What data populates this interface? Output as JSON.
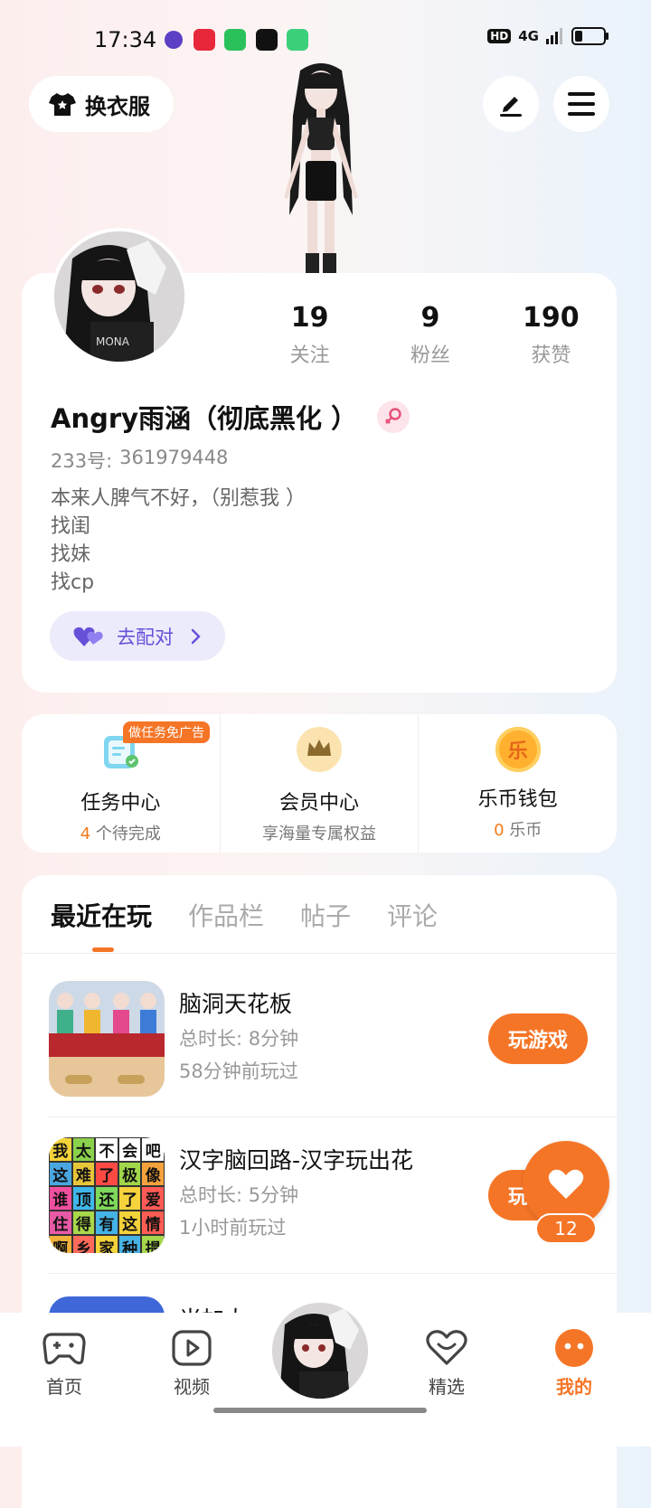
{
  "status_bar": {
    "time": "17:34",
    "hd": "HD",
    "network": "4G"
  },
  "header": {
    "outfit_label": "换衣服"
  },
  "profile": {
    "stats": [
      {
        "value": "19",
        "label": "关注"
      },
      {
        "value": "9",
        "label": "粉丝"
      },
      {
        "value": "190",
        "label": "获赞"
      }
    ],
    "username": "Angry雨涵（彻底黑化 ）",
    "id_label": "233号:",
    "id_value": "361979448",
    "bio": [
      "本来人脾气不好，（别惹我 ）",
      "找闺",
      "找妹",
      "找cp"
    ],
    "pair_label": "去配对"
  },
  "services": {
    "task": {
      "badge": "做任务免广告",
      "title": "任务中心",
      "count": "4",
      "sub": " 个待完成"
    },
    "vip": {
      "title": "会员中心",
      "sub": "享海量专属权益"
    },
    "wallet": {
      "title": "乐币钱包",
      "count": "0",
      "sub": " 乐币",
      "icon_text": "乐"
    }
  },
  "tabs": [
    "最近在玩",
    "作品栏",
    "帖子",
    "评论"
  ],
  "games": [
    {
      "name": "脑洞天花板",
      "duration": "总时长:  8分钟",
      "last_played": "58分钟前玩过",
      "button": "玩游戏"
    },
    {
      "name": "汉字脑回路-汉字玩出花",
      "duration": "总时长:  5分钟",
      "last_played": "1小时前玩过",
      "button": "玩游戏",
      "thumb_chars": [
        "我",
        "太",
        "不",
        "会",
        "吧",
        "这",
        "难",
        "了",
        "极",
        "像",
        "谁",
        "顶",
        "还",
        "了",
        "爱",
        "住",
        "得",
        "有",
        "这",
        "情",
        "啊",
        "乡",
        "家",
        "种",
        "提"
      ]
    },
    {
      "name": "当加大",
      "duration": "",
      "last_played": "",
      "button": ""
    }
  ],
  "like_count": "12",
  "nav": [
    "首页",
    "视频",
    "精选",
    "我的"
  ],
  "colors": {
    "accent": "#f57527",
    "pair": "#6650d8"
  }
}
